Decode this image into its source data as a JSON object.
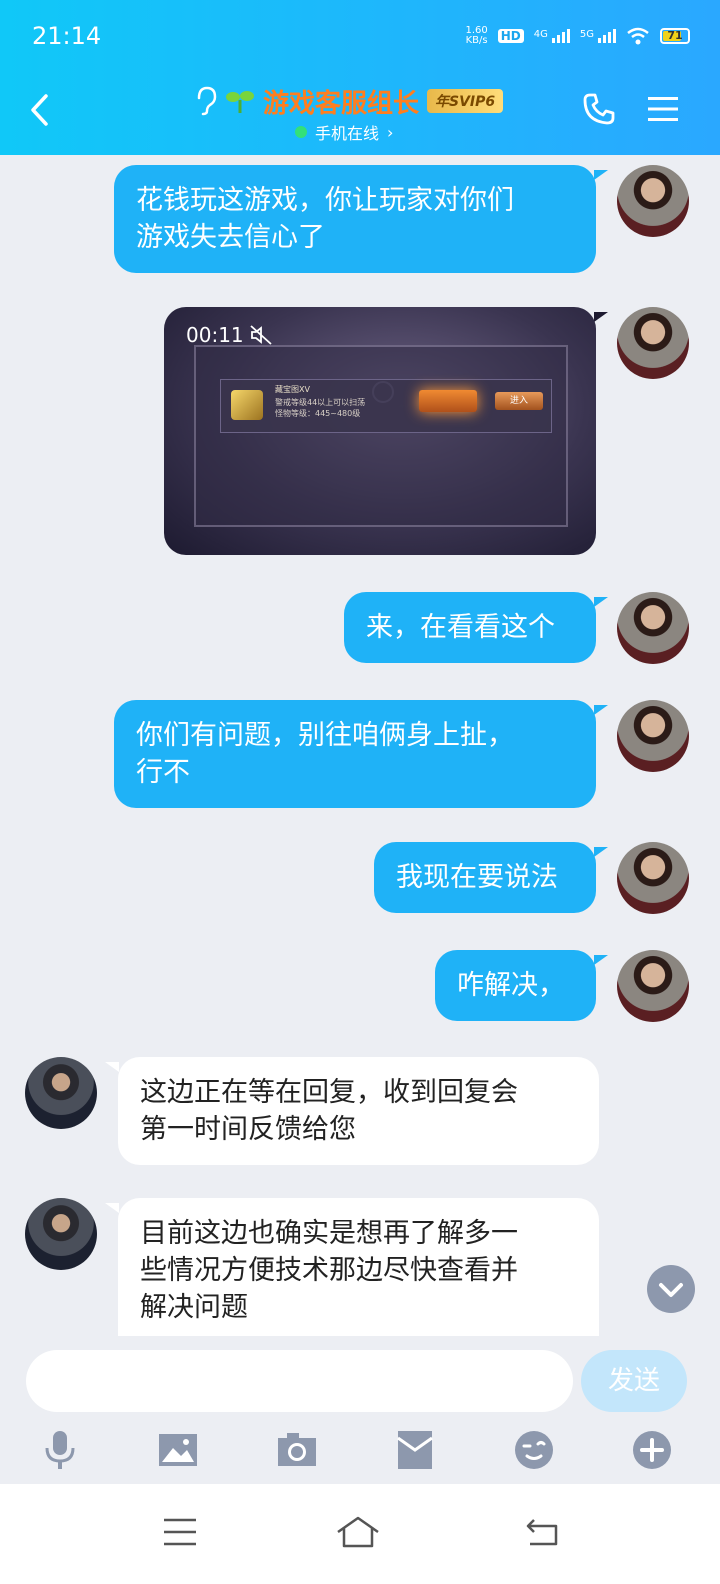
{
  "status_bar": {
    "time": "21:14",
    "net_speed": "1.60",
    "net_unit": "KB/s",
    "hd_label": "HD",
    "sim1": "4G",
    "sim2": "5G",
    "battery": "71"
  },
  "header": {
    "contact_name": "游戏客服组长",
    "vip_badge": "年SVIP6",
    "online_status": "手机在线",
    "online_arrow": "›"
  },
  "messages": [
    {
      "side": "right",
      "lines": [
        "花钱玩这游戏，你让玩家对你们",
        "游戏失去信心了"
      ]
    },
    {
      "side": "right",
      "type": "video",
      "duration": "00:11",
      "game_ui": {
        "title": "藏宝图XV",
        "line1": "警戒等级44以上可以扫荡",
        "line2": "怪物等级：445~480级",
        "enter": "进入"
      }
    },
    {
      "side": "right",
      "lines": [
        "来，在看看这个"
      ]
    },
    {
      "side": "right",
      "lines": [
        "你们有问题，别往咱俩身上扯，",
        "行不"
      ]
    },
    {
      "side": "right",
      "lines": [
        "我现在要说法"
      ]
    },
    {
      "side": "right",
      "lines": [
        "咋解决，"
      ]
    },
    {
      "side": "left",
      "lines": [
        "这边正在等在回复，收到回复会",
        "第一时间反馈给您"
      ]
    },
    {
      "side": "left",
      "lines": [
        "目前这边也确实是想再了解多一",
        "些情况方便技术那边尽快查看并",
        "解决问题"
      ]
    }
  ],
  "composer": {
    "placeholder": "",
    "send_label": "发送"
  },
  "colors": {
    "header_start": "#10c8f8",
    "header_end": "#2aa8ff",
    "bubble_right": "#1fb2f7",
    "bubble_left": "#ffffff",
    "contact_name": "#ff7e1f"
  },
  "icons": [
    "back-icon",
    "ear-icon",
    "sprout-icon",
    "phone-icon",
    "menu-icon",
    "scroll-down-icon",
    "microphone-icon",
    "image-icon",
    "camera-icon",
    "red-packet-icon",
    "emoji-icon",
    "plus-icon",
    "nav-menu-icon",
    "nav-home-icon",
    "nav-back-icon"
  ]
}
